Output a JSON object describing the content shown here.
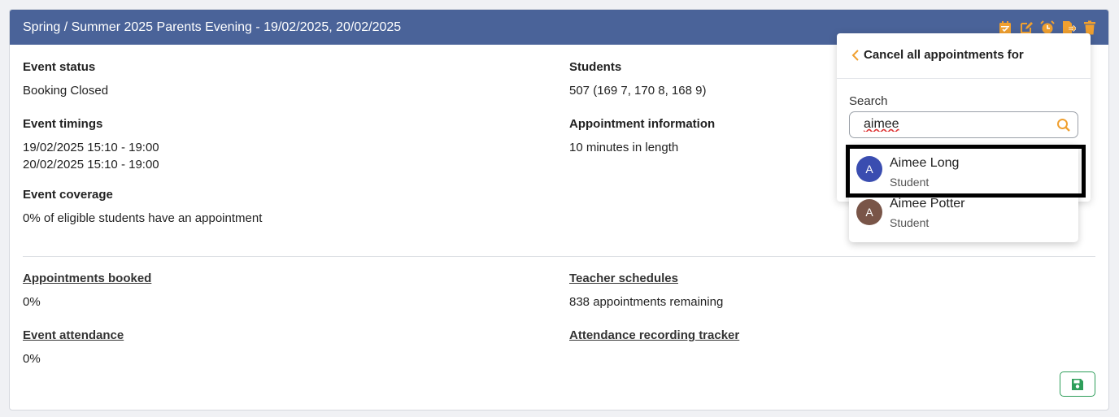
{
  "event": {
    "title": "Spring / Summer 2025 Parents Evening - 19/02/2025, 20/02/2025",
    "status_label": "Event status",
    "status_value": "Booking Closed",
    "timings_label": "Event timings",
    "timings": [
      "19/02/2025 15:10 - 19:00",
      "20/02/2025 15:10 - 19:00"
    ],
    "coverage_label": "Event coverage",
    "coverage_value": "0% of eligible students have an appointment",
    "students_label": "Students",
    "students_value": "507 (169 7, 170 8, 168 9)",
    "appointment_label": "Appointment information",
    "appointment_value": "10 minutes in length"
  },
  "stats": {
    "booked_label": "Appointments booked",
    "booked_value": "0%",
    "attendance_label": "Event attendance",
    "attendance_value": "0%",
    "schedules_label": "Teacher schedules",
    "schedules_value": "838 appointments remaining",
    "tracker_label": "Attendance recording tracker"
  },
  "header_icons": [
    "calendar-icon",
    "edit-icon",
    "alarm-icon",
    "export-icon",
    "trash-icon"
  ],
  "panel": {
    "title": "Cancel all appointments for",
    "search_label": "Search",
    "search_value": "aimee"
  },
  "results": [
    {
      "initial": "A",
      "name": "Aimee Long",
      "role": "Student",
      "color": "#3a4db0"
    },
    {
      "initial": "A",
      "name": "Aimee Potter",
      "role": "Student",
      "color": "#795548"
    }
  ],
  "colors": {
    "header": "#4a6399",
    "icon_accent": "#f0a030",
    "save_green": "#2e9e5a"
  }
}
